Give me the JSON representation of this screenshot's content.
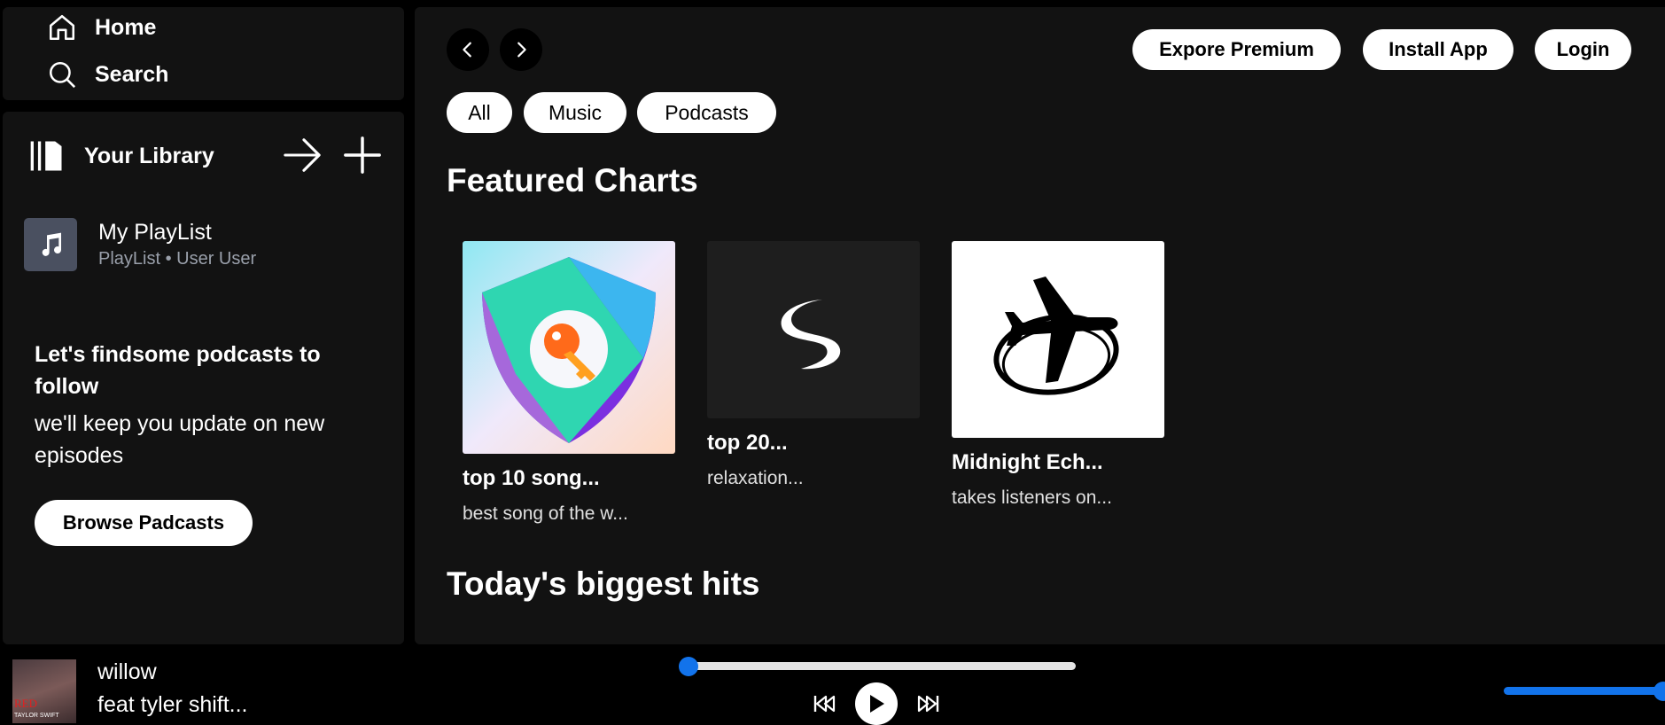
{
  "nav": {
    "home_label": "Home",
    "search_label": "Search"
  },
  "library": {
    "title": "Your Library",
    "playlist": {
      "name": "My PlayList",
      "subtitle": "PlayList • User User"
    },
    "promo_title": "Let's findsome podcasts to follow",
    "promo_text": "we'll keep you update on new episodes",
    "browse_label": "Browse Padcasts"
  },
  "header": {
    "premium_label": "Expore Premium",
    "install_label": "Install App",
    "login_label": "Login"
  },
  "filters": [
    "All",
    "Music",
    "Podcasts"
  ],
  "sections": {
    "featured_title": "Featured Charts",
    "hits_title": "Today's biggest hits"
  },
  "cards": [
    {
      "title": "top 10 song...",
      "subtitle": "best song of the w..."
    },
    {
      "title": "top 20...",
      "subtitle": "relaxation..."
    },
    {
      "title": "Midnight Ech...",
      "subtitle": "takes listeners on..."
    }
  ],
  "now_playing": {
    "title": "willow",
    "artist": "feat tyler shift...",
    "cover_text_top": "RED",
    "cover_text_bottom": "TAYLOR SWIFT",
    "progress_fraction": 0.0,
    "volume_fraction": 1.0
  },
  "colors": {
    "accent": "#1273eb",
    "panel": "#121212",
    "background": "#000000"
  },
  "icons": [
    "home-icon",
    "search-icon",
    "library-icon",
    "arrow-right-icon",
    "plus-icon",
    "music-note-icon",
    "chevron-left-icon",
    "chevron-right-icon",
    "skip-back-icon",
    "play-icon",
    "skip-forward-icon"
  ]
}
